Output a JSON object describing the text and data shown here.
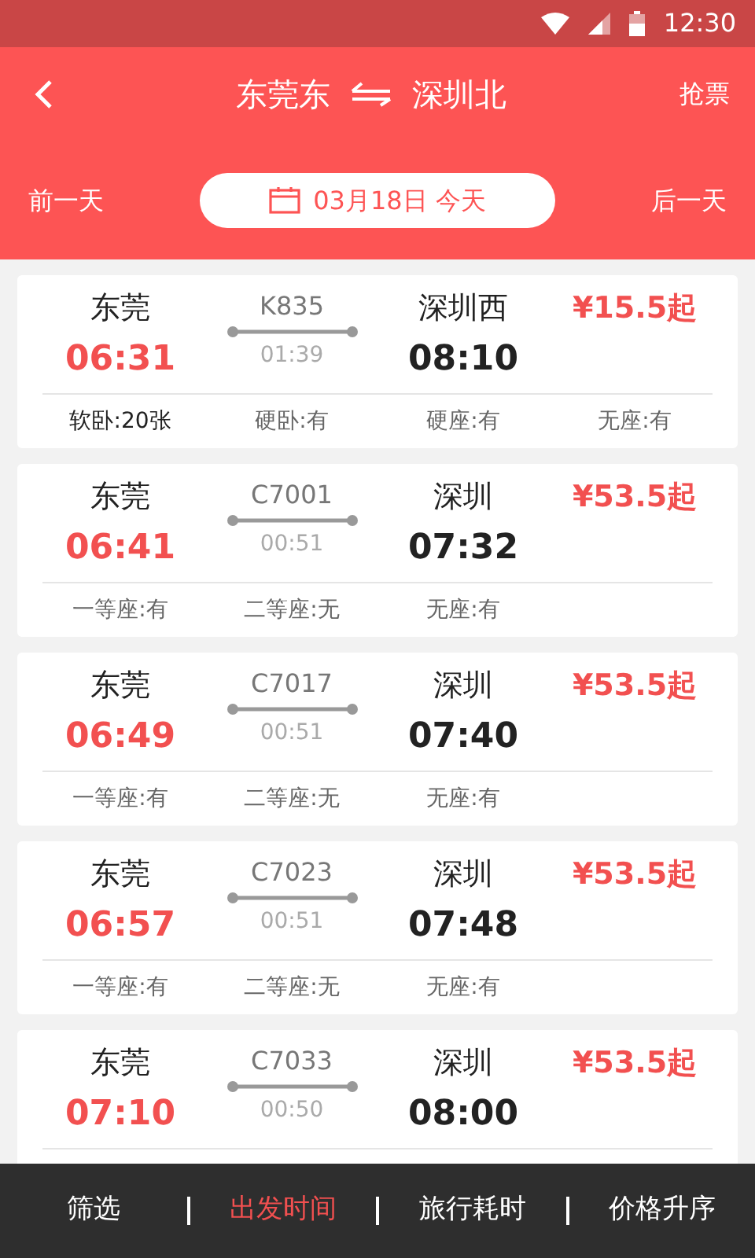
{
  "status_bar": {
    "time": "12:30"
  },
  "header": {
    "from": "东莞东",
    "to": "深圳北",
    "action": "抢票"
  },
  "date_bar": {
    "prev": "前一天",
    "date": "03月18日 今天",
    "next": "后一天"
  },
  "trains": [
    {
      "from": "东莞",
      "depart": "06:31",
      "number": "K835",
      "duration": "01:39",
      "to": "深圳西",
      "arrive": "08:10",
      "price": "¥15.5起",
      "seats": [
        {
          "text": "软卧:20张",
          "emphasized": true
        },
        {
          "text": "硬卧:有",
          "emphasized": false
        },
        {
          "text": "硬座:有",
          "emphasized": false
        },
        {
          "text": "无座:有",
          "emphasized": false
        }
      ]
    },
    {
      "from": "东莞",
      "depart": "06:41",
      "number": "C7001",
      "duration": "00:51",
      "to": "深圳",
      "arrive": "07:32",
      "price": "¥53.5起",
      "seats": [
        {
          "text": "一等座:有",
          "emphasized": false
        },
        {
          "text": "二等座:无",
          "emphasized": false
        },
        {
          "text": "无座:有",
          "emphasized": false
        }
      ]
    },
    {
      "from": "东莞",
      "depart": "06:49",
      "number": "C7017",
      "duration": "00:51",
      "to": "深圳",
      "arrive": "07:40",
      "price": "¥53.5起",
      "seats": [
        {
          "text": "一等座:有",
          "emphasized": false
        },
        {
          "text": "二等座:无",
          "emphasized": false
        },
        {
          "text": "无座:有",
          "emphasized": false
        }
      ]
    },
    {
      "from": "东莞",
      "depart": "06:57",
      "number": "C7023",
      "duration": "00:51",
      "to": "深圳",
      "arrive": "07:48",
      "price": "¥53.5起",
      "seats": [
        {
          "text": "一等座:有",
          "emphasized": false
        },
        {
          "text": "二等座:无",
          "emphasized": false
        },
        {
          "text": "无座:有",
          "emphasized": false
        }
      ]
    },
    {
      "from": "东莞",
      "depart": "07:10",
      "number": "C7033",
      "duration": "00:50",
      "to": "深圳",
      "arrive": "08:00",
      "price": "¥53.5起"
    }
  ],
  "sort_bar": [
    {
      "label": "筛选",
      "selected": false
    },
    {
      "label": "出发时间",
      "selected": true
    },
    {
      "label": "旅行耗时",
      "selected": false
    },
    {
      "label": "价格升序",
      "selected": false
    }
  ]
}
